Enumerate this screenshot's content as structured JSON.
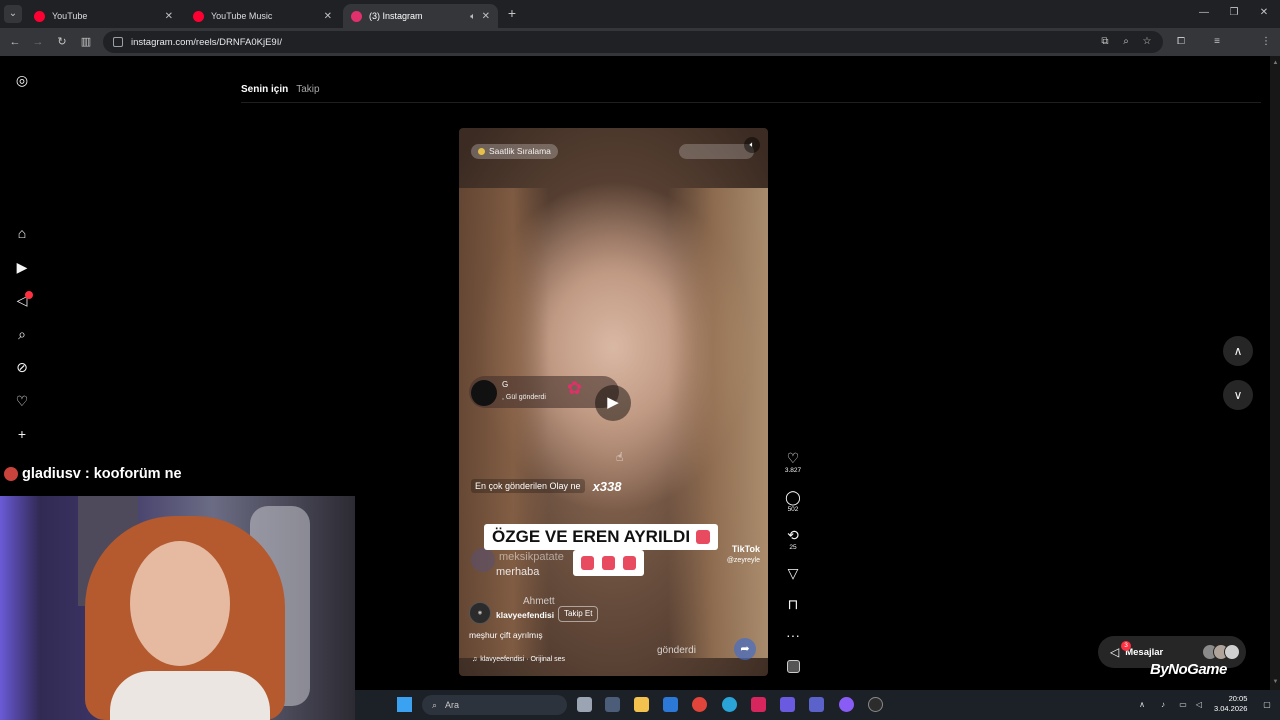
{
  "browser": {
    "tabs": [
      {
        "title": "YouTube",
        "icon": "youtube-icon",
        "color": "#ff0033"
      },
      {
        "title": "YouTube Music",
        "icon": "youtube-music-icon",
        "color": "#ff0033"
      },
      {
        "title": "(3) Instagram",
        "icon": "instagram-icon",
        "color": "#e1306c"
      }
    ],
    "url": "instagram.com/reels/DRNFA0KjE9I/"
  },
  "sidebar": {
    "icons": [
      "instagram-logo-icon",
      "home-icon",
      "reels-icon",
      "messages-icon",
      "search-icon",
      "explore-icon",
      "notifications-icon",
      "create-icon"
    ]
  },
  "feed_tabs": {
    "for_you": "Senin için",
    "following": "Takip"
  },
  "reel": {
    "top_label": "Saatlik Sıralama",
    "gift_name": "G",
    "gift_text": ", Gül  gönderdi",
    "sent_label": "En çok gönderilen Olay ne",
    "sent_multiplier": "x338",
    "headline": "ÖZGE VE EREN AYRILDI",
    "chat_ghost_name": "meksikpatate",
    "chat_ghost_message": "merhaba",
    "ghost_name_2": "Ahmett",
    "ghost_send": "gönderdi",
    "tiktok_label": "TikTok",
    "tiktok_handle": "@zeyreyle",
    "author": "klavyeefendisi",
    "follow_label": "Takip Et",
    "caption": "meşhur çift ayrılmış",
    "audio": "klavyeefendisi · Orijinal ses"
  },
  "actions": {
    "likes": "3.827",
    "comments": "502",
    "reposts": "25"
  },
  "messages": {
    "label": "Mesajlar",
    "badge": "3"
  },
  "overlay": {
    "chat_line": "gladiusv : kooforüm ne",
    "brand": "ByNoGame"
  },
  "taskbar": {
    "search_placeholder": "Ara",
    "time": "20:05",
    "date": "3.04.2026"
  }
}
